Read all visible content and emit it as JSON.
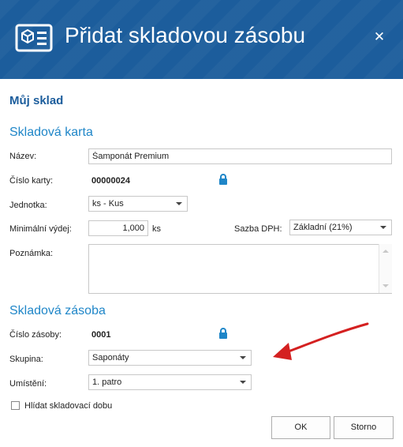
{
  "window": {
    "title": "Přidat skladovou zásobu",
    "close_symbol": "✕"
  },
  "company": "Můj sklad",
  "card": {
    "heading": "Skladová karta",
    "name_label": "Název:",
    "name_value": "Šamponát Premium",
    "number_label": "Číslo karty:",
    "number_value": "00000024",
    "unit_label": "Jednotka:",
    "unit_value": "ks - Kus",
    "min_label": "Minimální výdej:",
    "min_value": "1,000",
    "min_unit": "ks",
    "vat_label": "Sazba DPH:",
    "vat_value": "Základní (21%)",
    "note_label": "Poznámka:",
    "note_value": ""
  },
  "stock": {
    "heading": "Skladová zásoba",
    "number_label": "Číslo zásoby:",
    "number_value": "0001",
    "group_label": "Skupina:",
    "group_value": "Saponáty",
    "location_label": "Umístění:",
    "location_value": "1. patro",
    "checkbox_label": "Hlídat skladovací dobu",
    "checkbox_checked": false
  },
  "buttons": {
    "ok": "OK",
    "cancel": "Storno"
  },
  "colors": {
    "titlebar": "#1c5d9c",
    "heading": "#1f86c8",
    "lock": "#1f86c8",
    "annotation_arrow": "#d42020"
  }
}
